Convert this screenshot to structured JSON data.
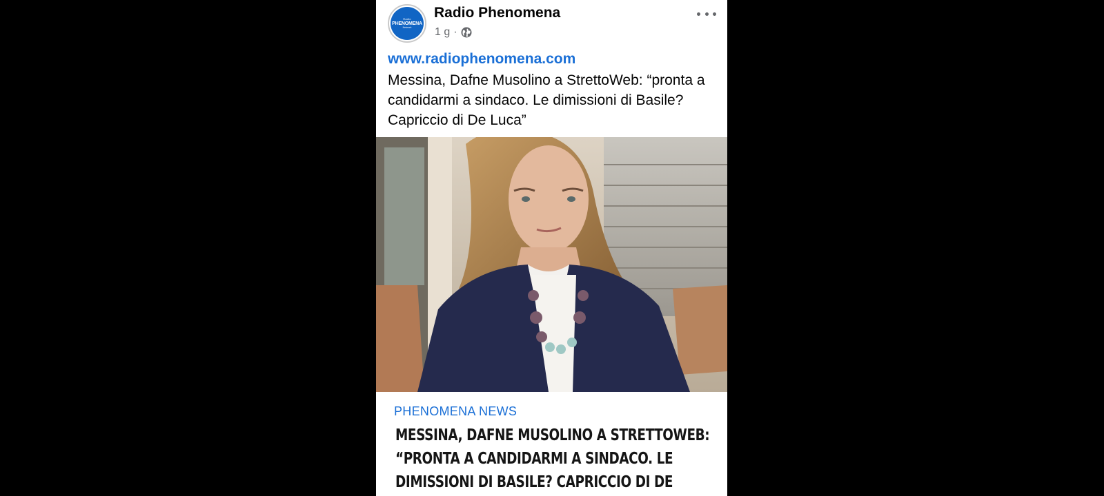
{
  "post": {
    "page_name": "Radio Phenomena",
    "time": "1 g",
    "separator": "·",
    "privacy_icon": "globe-icon",
    "avatar": {
      "line1": "Radio",
      "line2": "PHENOMENA",
      "line3": "Network"
    },
    "link_url": "www.radiophenomena.com",
    "text": "Messina, Dafne Musolino a StrettoWeb: “pronta a candidarmi a sindaco. Le dimissioni di Basile? Capriccio di De Luca”"
  },
  "preview": {
    "source": "PHENOMENA NEWS",
    "headline": "MESSINA, DAFNE MUSOLINO A STRETTOWEB: “PRONTA A CANDIDARMI A SINDACO. LE DIMISSIONI DI BASILE? CAPRICCIO DI DE LUCA”"
  },
  "colors": {
    "background": "#000000",
    "card": "#ffffff",
    "link": "#1a6fd6",
    "brand": "#1165c4",
    "meta": "#65676b"
  }
}
